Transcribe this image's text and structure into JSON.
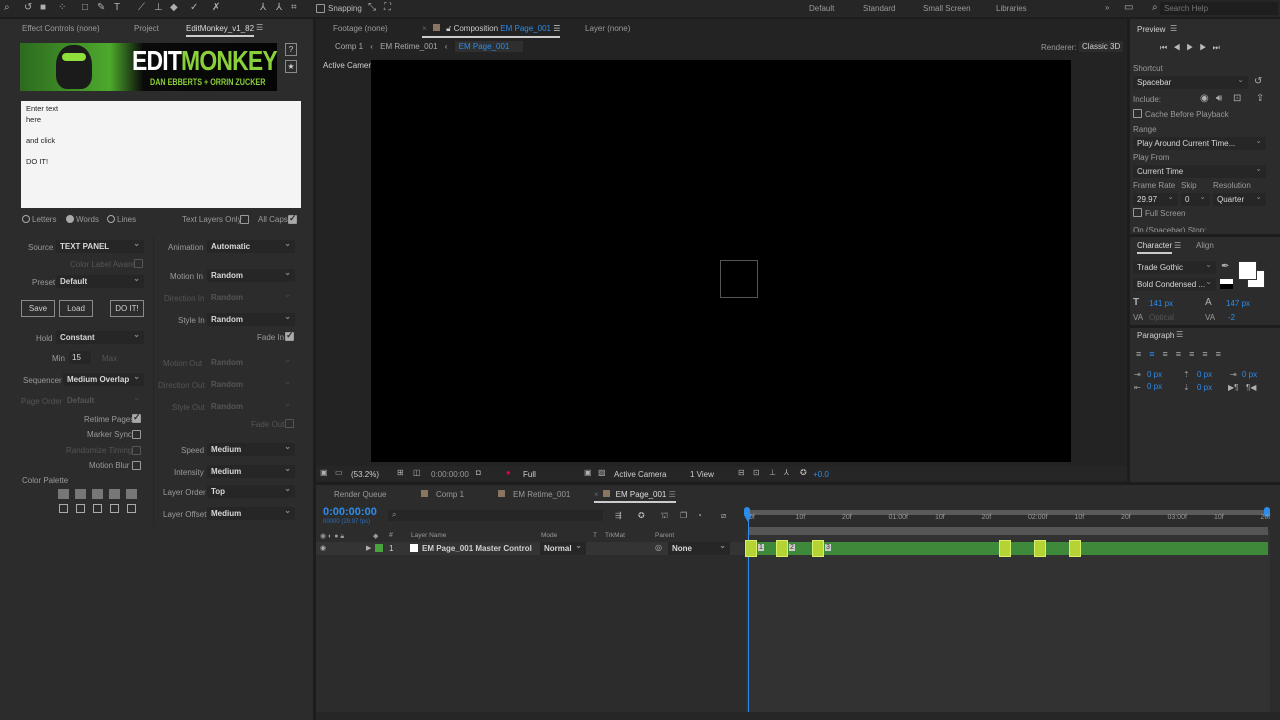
{
  "toolbar": {
    "snapping": "Snapping",
    "workspaces": [
      "Default",
      "Standard",
      "Small Screen",
      "Libraries"
    ],
    "more": "»",
    "search_placeholder": "Search Help"
  },
  "left_panel": {
    "tabs": [
      "Effect Controls (none)",
      "Project",
      "EditMonkey_v1_82"
    ],
    "logo": {
      "title_white": "EDIT",
      "title_green": "MONKEY",
      "subtitle": "DAN EBBERTS + ORRIN ZUCKER"
    },
    "help_button": "?",
    "star_button": "★",
    "text_input": "Enter text\nhere\n\nand click\n\nDO IT!",
    "split": {
      "letters": "Letters",
      "words": "Words",
      "lines": "Lines",
      "selected": "Words"
    },
    "text_layers_only": {
      "label": "Text Layers Only",
      "checked": false
    },
    "all_caps": {
      "label": "All Caps",
      "checked": true
    },
    "source": {
      "label": "Source",
      "value": "TEXT PANEL"
    },
    "color_label_aware": {
      "label": "Color Label Aware",
      "checked": false
    },
    "preset": {
      "label": "Preset",
      "value": "Default"
    },
    "buttons": {
      "save": "Save",
      "load": "Load",
      "do_it": "DO IT!"
    },
    "hold": {
      "label": "Hold",
      "value": "Constant"
    },
    "min": {
      "label": "Min",
      "value": "15"
    },
    "max": {
      "label": "Max"
    },
    "sequencer": {
      "label": "Sequencer",
      "value": "Medium Overlap"
    },
    "page_order": {
      "label": "Page Order",
      "value": "Default"
    },
    "retime_pages": {
      "label": "Retime Pages",
      "checked": true
    },
    "marker_sync": {
      "label": "Marker Sync",
      "checked": false
    },
    "randomize_timing": {
      "label": "Randomize Timing",
      "checked": false
    },
    "motion_blur": {
      "label": "Motion Blur",
      "checked": false
    },
    "color_palette": "Color Palette",
    "animation": {
      "label": "Animation",
      "value": "Automatic"
    },
    "motion_in": {
      "label": "Motion In",
      "value": "Random"
    },
    "direction_in": {
      "label": "Direction In",
      "value": "Random"
    },
    "style_in": {
      "label": "Style In",
      "value": "Random"
    },
    "fade_in": {
      "label": "Fade In",
      "checked": true
    },
    "motion_out": {
      "label": "Motion Out",
      "value": "Random"
    },
    "direction_out": {
      "label": "Direction Out",
      "value": "Random"
    },
    "style_out": {
      "label": "Style Out",
      "value": "Random"
    },
    "fade_out": {
      "label": "Fade Out",
      "checked": true
    },
    "speed": {
      "label": "Speed",
      "value": "Medium"
    },
    "intensity": {
      "label": "Intensity",
      "value": "Medium"
    },
    "layer_order": {
      "label": "Layer Order",
      "value": "Top"
    },
    "layer_offset": {
      "label": "Layer Offset",
      "value": "Medium"
    }
  },
  "comp_panel": {
    "tabs": {
      "footage": "Footage (none)",
      "composition_prefix": "Composition",
      "composition_name": "EM Page_001",
      "layer": "Layer (none)"
    },
    "breadcrumbs": [
      "Comp 1",
      "EM Retime_001",
      "EM Page_001"
    ],
    "renderer_label": "Renderer:",
    "renderer_value": "Classic 3D",
    "view_label": "Active Camera",
    "bottom_bar": {
      "zoom": "(53.2%)",
      "timecode": "0:00:00:00",
      "resolution": "Full",
      "camera": "Active Camera",
      "views": "1 View",
      "exposure": "+0.0"
    }
  },
  "right_panel": {
    "preview": {
      "title": "Preview",
      "shortcut_label": "Shortcut",
      "shortcut": "Spacebar",
      "include_label": "Include:",
      "cache": {
        "label": "Cache Before Playback",
        "checked": false
      },
      "range_label": "Range",
      "range": "Play Around Current Time...",
      "play_from_label": "Play From",
      "play_from": "Current Time",
      "frame_rate_label": "Frame Rate",
      "frame_rate": "29.97",
      "skip_label": "Skip",
      "skip": "0",
      "resolution_label": "Resolution",
      "resolution": "Quarter",
      "full_screen": {
        "label": "Full Screen",
        "checked": false
      },
      "stop_label": "On (Spacebar) Stop:"
    },
    "character": {
      "tabs": [
        "Character",
        "Align"
      ],
      "font": "Trade Gothic",
      "style": "Bold Condensed ...",
      "size": "141 px",
      "leading": "147 px",
      "kerning": "Optical",
      "tracking": "-2"
    },
    "paragraph": {
      "title": "Paragraph",
      "indent_left": "0 px",
      "space_before": "0 px",
      "indent_first": "0 px",
      "indent_right": "0 px",
      "space_after": "0 px"
    }
  },
  "timeline": {
    "tabs": [
      "Render Queue",
      "Comp 1",
      "EM Retime_001",
      "EM Page_001"
    ],
    "timecode": "0:00:00:00",
    "frame_info": "00000 (29.97 fps)",
    "columns": {
      "layer_name": "Layer Name",
      "mode": "Mode",
      "t": "T",
      "trkmat": "TrkMat",
      "parent": "Parent",
      "number": "#"
    },
    "layers": [
      {
        "number": "1",
        "name": "EM Page_001 Master Control",
        "mode": "Normal",
        "parent": "None"
      }
    ],
    "ruler": [
      "0f",
      "10f",
      "20f",
      "01:00f",
      "10f",
      "20f",
      "02:00f",
      "10f",
      "20f",
      "03:00f",
      "10f",
      "20f"
    ],
    "markers": [
      "1",
      "2",
      "3",
      "",
      "",
      ""
    ],
    "colors": {
      "layer_bar": "#3f8a3a",
      "keyframe": "#b5d334",
      "accent": "#2d8ceb"
    }
  }
}
